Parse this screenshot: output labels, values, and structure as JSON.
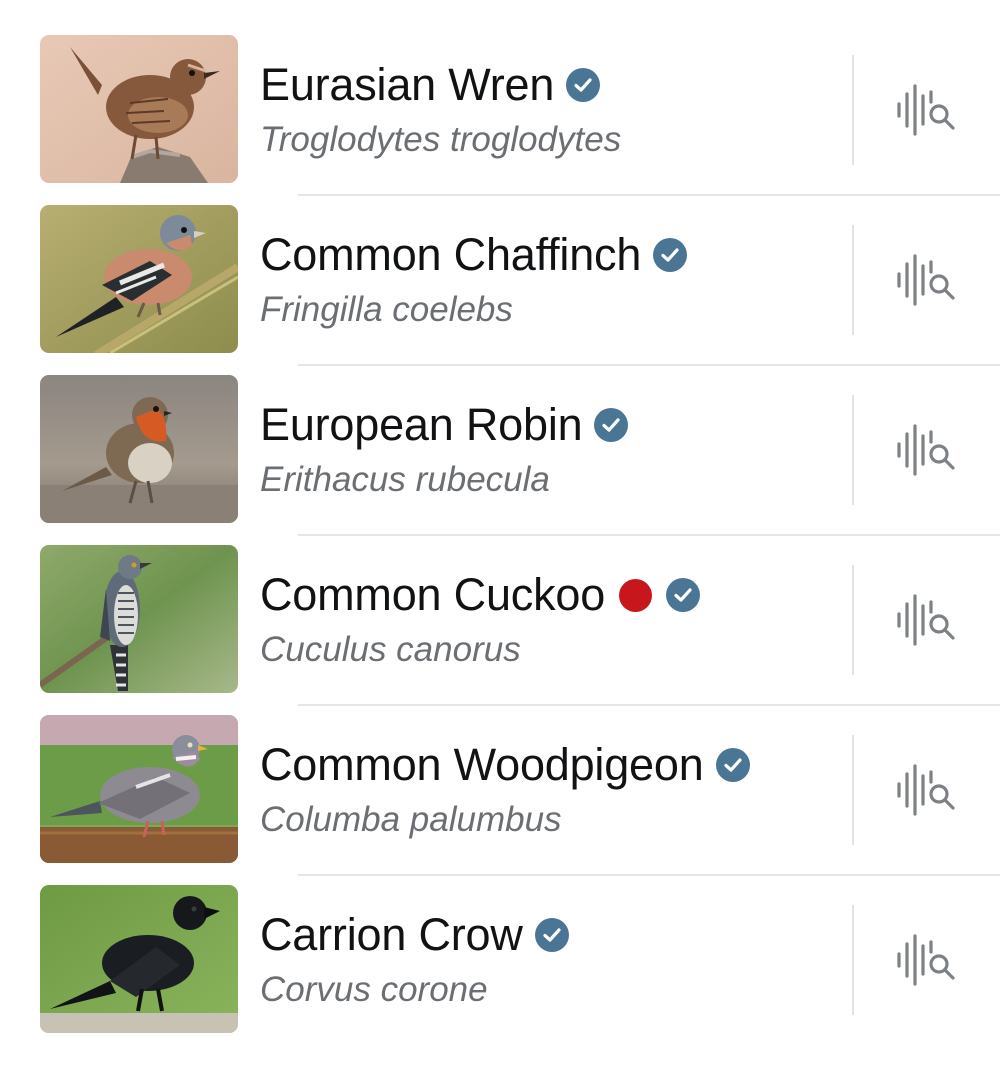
{
  "species": [
    {
      "common_name": "Eurasian Wren",
      "scientific_name": "Troglodytes troglodytes",
      "verified": true,
      "red_list": false,
      "photo": "eurasian-wren-photo",
      "action_icon": "sound-search-icon"
    },
    {
      "common_name": "Common Chaffinch",
      "scientific_name": "Fringilla coelebs",
      "verified": true,
      "red_list": false,
      "photo": "common-chaffinch-photo",
      "action_icon": "sound-search-icon"
    },
    {
      "common_name": "European Robin",
      "scientific_name": "Erithacus rubecula",
      "verified": true,
      "red_list": false,
      "photo": "european-robin-photo",
      "action_icon": "sound-search-icon"
    },
    {
      "common_name": "Common Cuckoo",
      "scientific_name": "Cuculus canorus",
      "verified": true,
      "red_list": true,
      "photo": "common-cuckoo-photo",
      "action_icon": "sound-search-icon"
    },
    {
      "common_name": "Common Woodpigeon",
      "scientific_name": "Columba palumbus",
      "verified": true,
      "red_list": false,
      "photo": "common-woodpigeon-photo",
      "action_icon": "sound-search-icon"
    },
    {
      "common_name": "Carrion Crow",
      "scientific_name": "Corvus corone",
      "verified": true,
      "red_list": false,
      "photo": "carrion-crow-photo",
      "action_icon": "sound-search-icon"
    }
  ],
  "colors": {
    "verified_badge": "#4a7594",
    "red_list_dot": "#c8161d",
    "icon": "#7d8085",
    "divider": "#e3e3e5"
  }
}
